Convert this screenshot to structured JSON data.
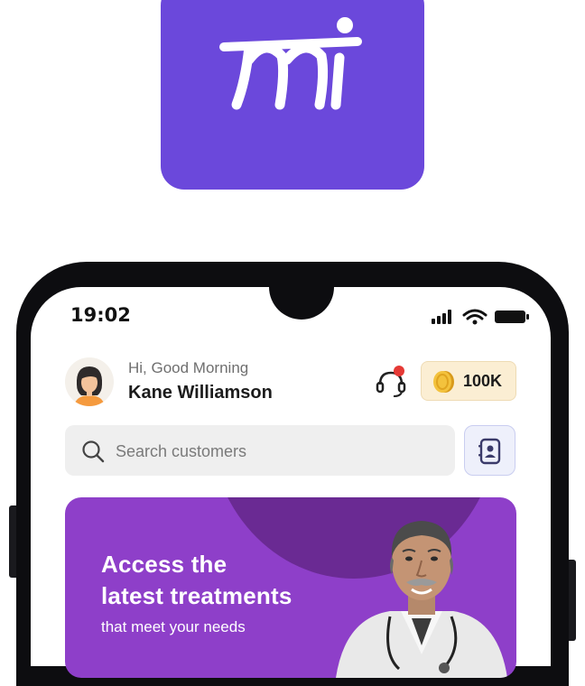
{
  "status_bar": {
    "time": "19:02"
  },
  "header": {
    "greeting": "Hi, Good Morning",
    "user_name": "Kane Williamson",
    "coins": "100K"
  },
  "search": {
    "placeholder": "Search customers"
  },
  "banner": {
    "line1": "Access the",
    "line2": "latest treatments",
    "line3": "that meet your needs"
  },
  "icons": {
    "app_logo": "mi-logo-icon",
    "support": "headset-icon",
    "coin": "coin-icon",
    "search": "search-icon",
    "contacts": "contact-book-icon"
  },
  "colors": {
    "brand_purple": "#6b48db",
    "banner_purple": "#8e3fc9",
    "banner_dark": "#6a2a93",
    "coin_bg": "#fbeed3",
    "notification_red": "#e53935"
  }
}
